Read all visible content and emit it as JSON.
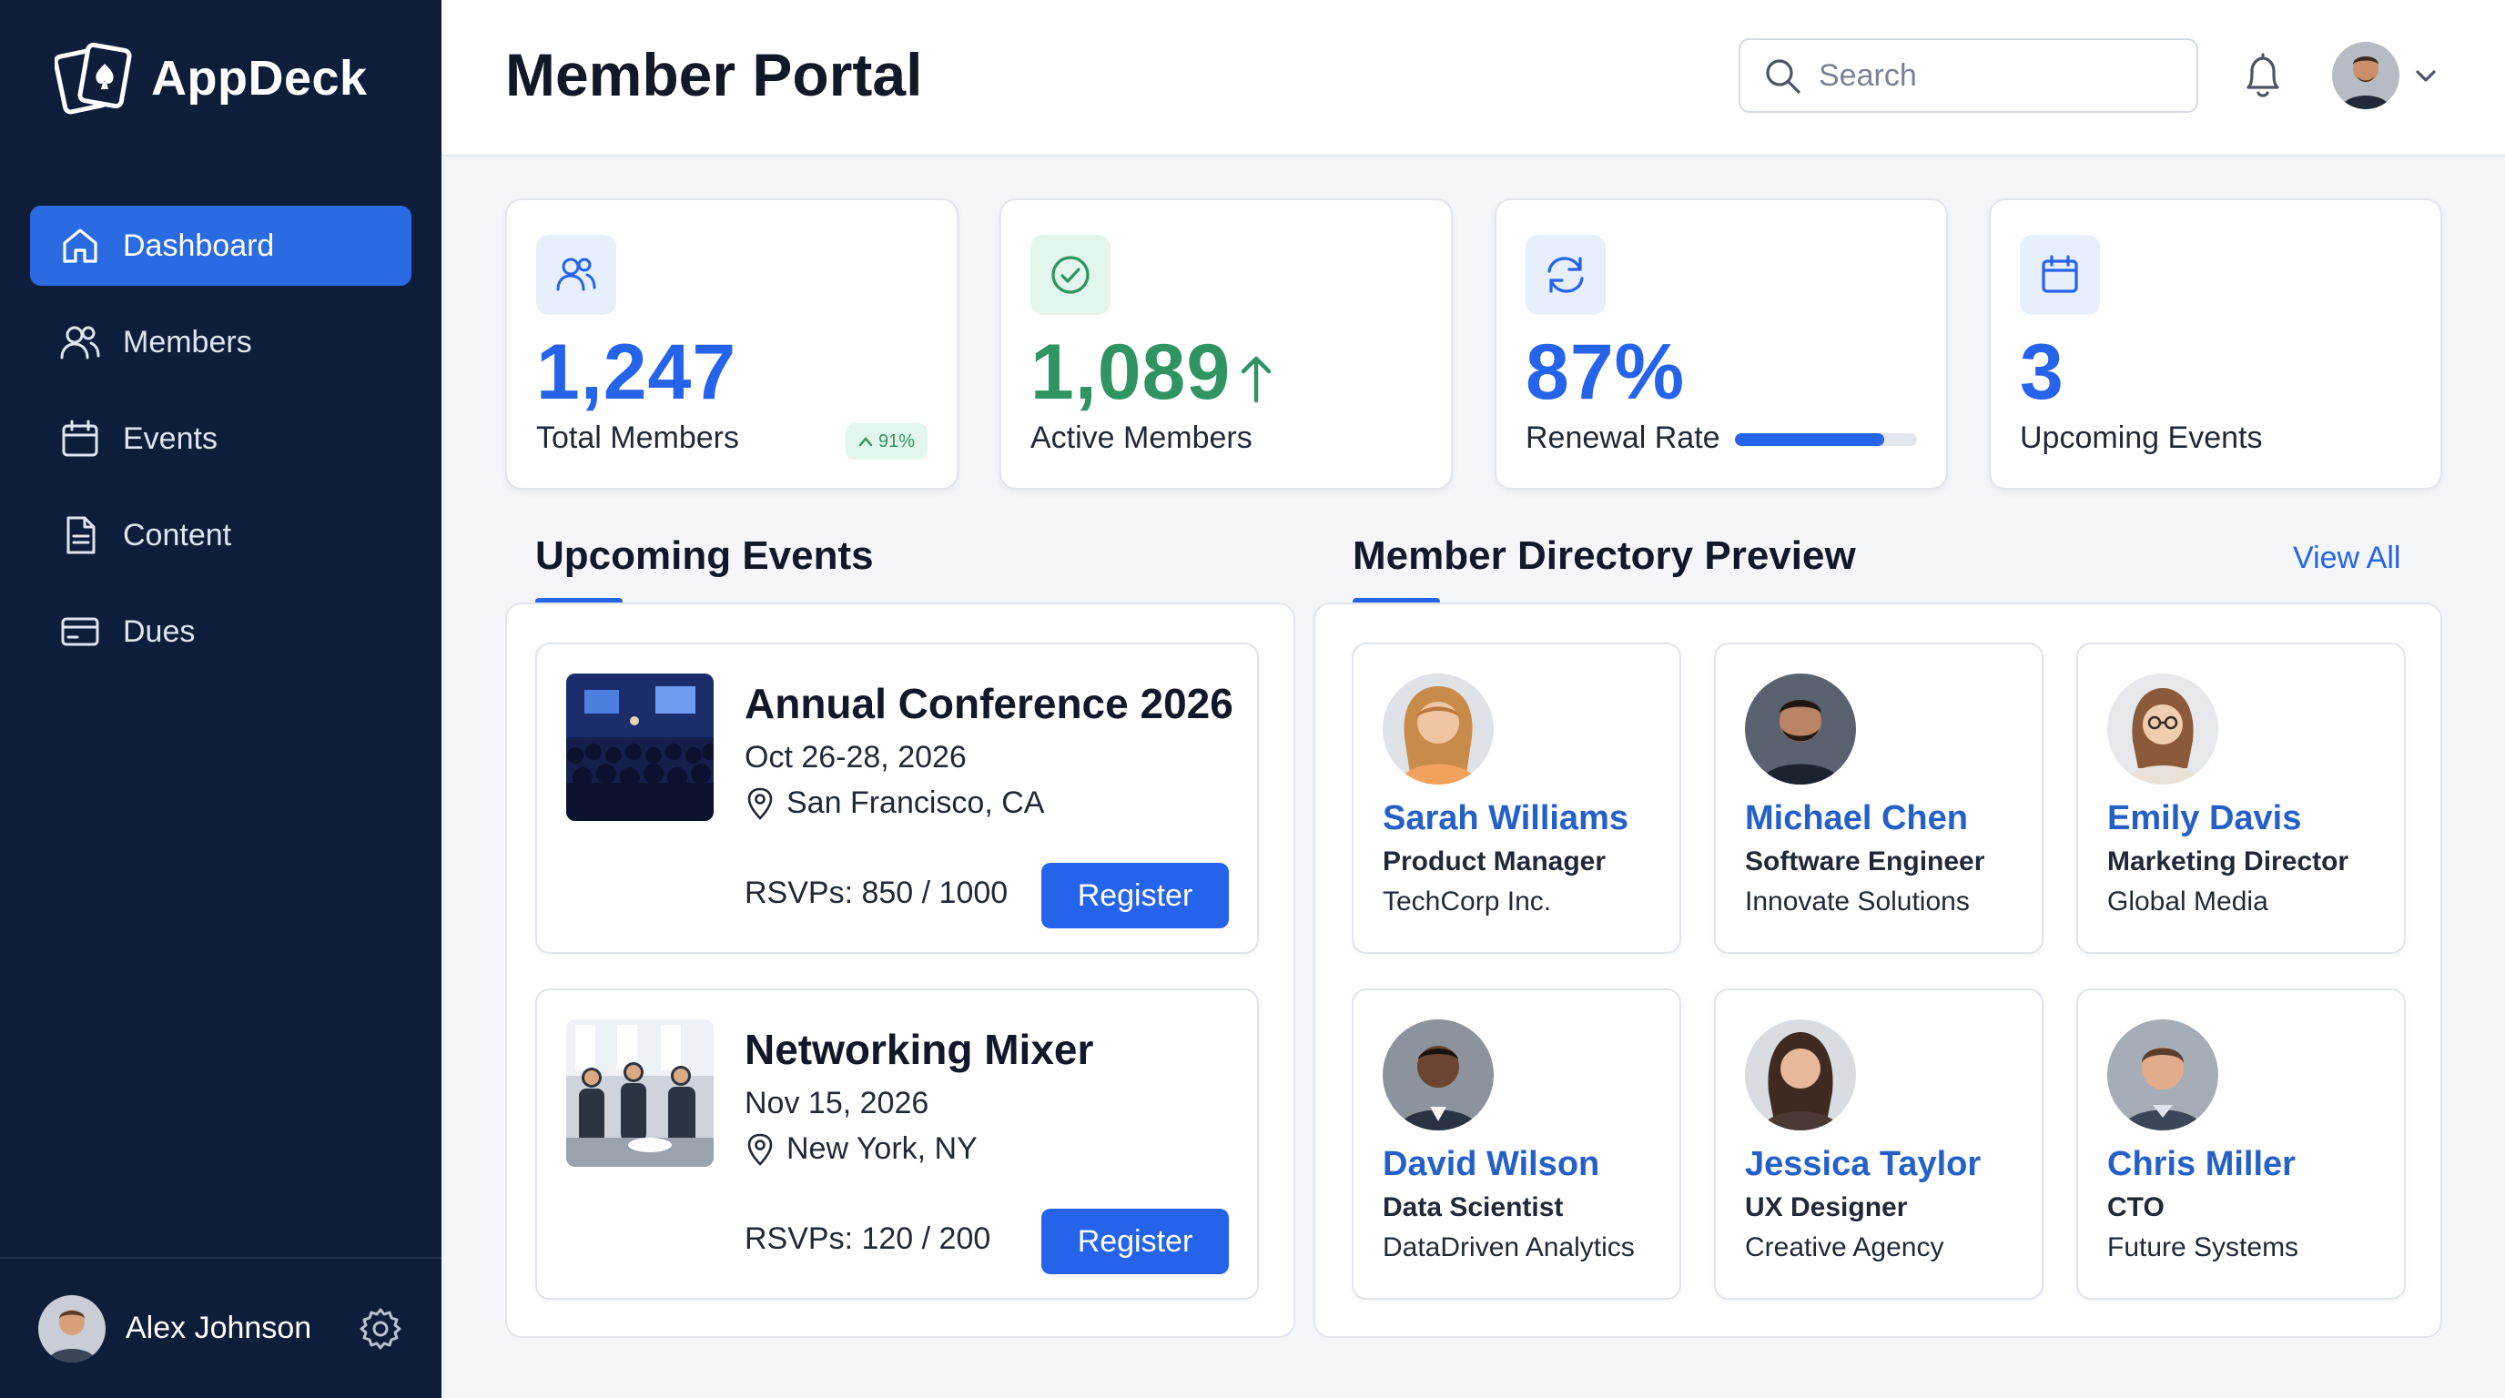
{
  "brand": {
    "name": "AppDeck"
  },
  "sidebar": {
    "items": [
      {
        "label": "Dashboard",
        "icon": "home-icon",
        "active": true
      },
      {
        "label": "Members",
        "icon": "users-icon",
        "active": false
      },
      {
        "label": "Events",
        "icon": "calendar-icon",
        "active": false
      },
      {
        "label": "Content",
        "icon": "document-icon",
        "active": false
      },
      {
        "label": "Dues",
        "icon": "credit-card-icon",
        "active": false
      }
    ],
    "user": {
      "name": "Alex Johnson"
    }
  },
  "header": {
    "title": "Member Portal",
    "search_placeholder": "Search"
  },
  "stats": [
    {
      "value": "1,247",
      "label": "Total Members",
      "badge": "91%",
      "icon": "users-icon",
      "color": "#2563eb"
    },
    {
      "value": "1,089",
      "label": "Active Members",
      "icon": "check-circle-icon",
      "color": "#2f9461",
      "trend": "up"
    },
    {
      "value": "87%",
      "label": "Renewal Rate",
      "icon": "refresh-icon",
      "color": "#2563eb",
      "progress": 0.82
    },
    {
      "value": "3",
      "label": "Upcoming Events",
      "icon": "calendar-icon",
      "color": "#2563eb"
    }
  ],
  "events_section": {
    "title": "Upcoming Events",
    "events": [
      {
        "title": "Annual Conference 2026",
        "date": "Oct 26-28, 2026",
        "location": "San Francisco, CA",
        "rsvp": "RSVPs: 850 / 1000",
        "button": "Register"
      },
      {
        "title": "Networking Mixer",
        "date": "Nov 15, 2026",
        "location": "New York, NY",
        "rsvp": "RSVPs: 120 / 200",
        "button": "Register"
      }
    ]
  },
  "directory": {
    "title": "Member Directory Preview",
    "view_all": "View All",
    "members": [
      {
        "name": "Sarah Williams",
        "role": "Product Manager",
        "company": "TechCorp Inc."
      },
      {
        "name": "Michael Chen",
        "role": "Software Engineer",
        "company": "Innovate Solutions"
      },
      {
        "name": "Emily Davis",
        "role": "Marketing Director",
        "company": "Global Media"
      },
      {
        "name": "David Wilson",
        "role": "Data Scientist",
        "company": "DataDriven Analytics"
      },
      {
        "name": "Jessica Taylor",
        "role": "UX Designer",
        "company": "Creative Agency"
      },
      {
        "name": "Chris Miller",
        "role": "CTO",
        "company": "Future Systems"
      }
    ]
  },
  "colors": {
    "sidebar_bg": "#0e1e3a",
    "accent": "#2563eb",
    "success": "#2f9461",
    "member_name": "#2560c9"
  }
}
